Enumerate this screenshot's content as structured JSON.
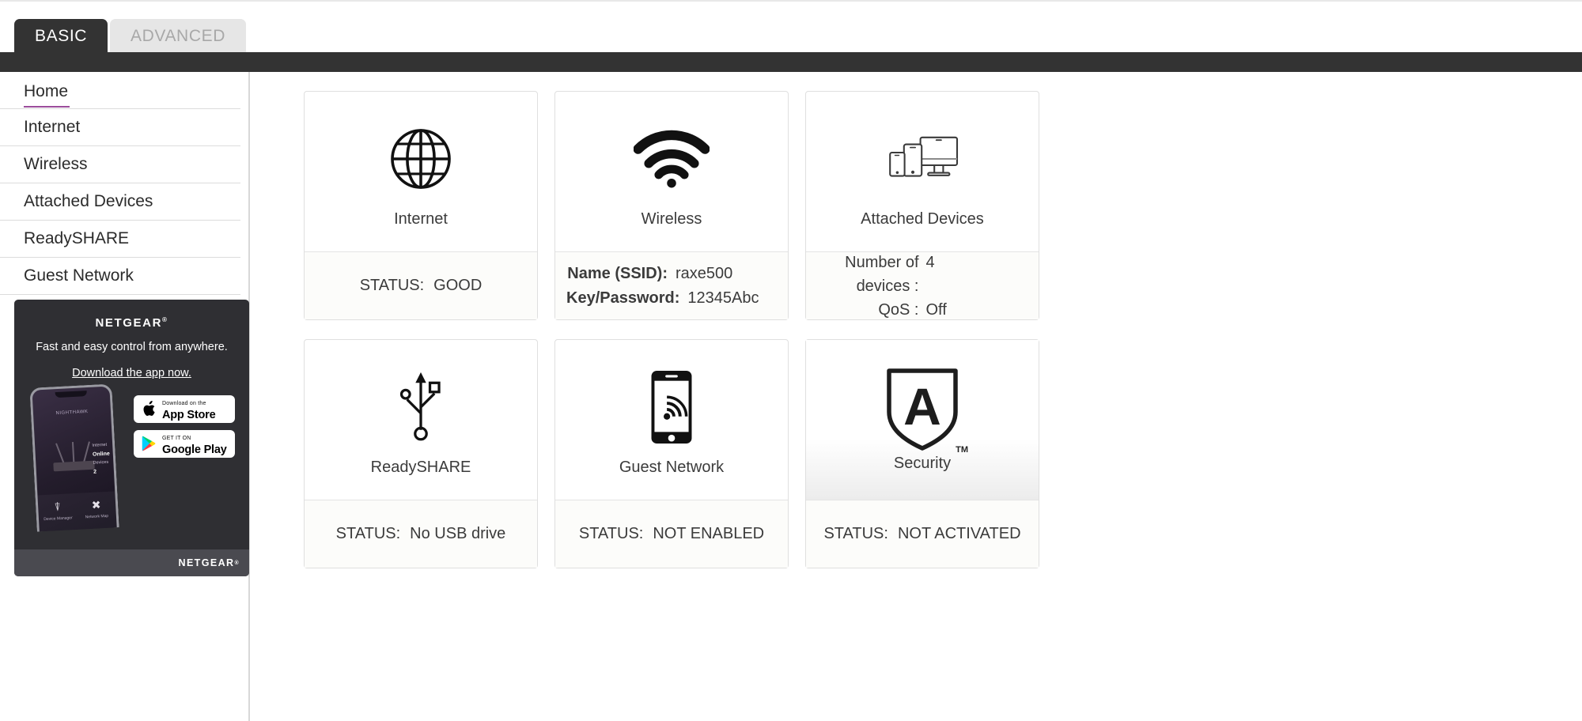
{
  "tabs": [
    {
      "label": "BASIC",
      "active": true
    },
    {
      "label": "ADVANCED",
      "active": false
    }
  ],
  "sidebar": {
    "items": [
      {
        "label": "Home",
        "active": true
      },
      {
        "label": "Internet",
        "active": false
      },
      {
        "label": "Wireless",
        "active": false
      },
      {
        "label": "Attached Devices",
        "active": false
      },
      {
        "label": "ReadySHARE",
        "active": false
      },
      {
        "label": "Guest Network",
        "active": false
      }
    ],
    "active_accent": "#9c4d9c"
  },
  "promo": {
    "brand": "NETGEAR",
    "trademark": "®",
    "tagline": "Fast and easy control from anywhere.",
    "link": "Download the app now.",
    "phone": {
      "app_title": "NIGHTHAWK",
      "status_label": "Internet",
      "status_value": "Online",
      "devices_label": "Devices",
      "devices_value": "2",
      "foot_left": "Device Manager",
      "foot_right": "Network Map"
    },
    "badges": [
      {
        "small": "Download on the",
        "big": "App Store",
        "icon": "apple-icon"
      },
      {
        "small": "GET IT ON",
        "big": "Google Play",
        "icon": "google-play-icon"
      }
    ],
    "footer_brand": "NETGEAR",
    "footer_trademark": "®"
  },
  "cards": [
    {
      "id": "internet",
      "icon": "globe-icon",
      "label": "Internet",
      "foot_type": "status",
      "status_label": "STATUS:",
      "status_value": "GOOD"
    },
    {
      "id": "wireless",
      "icon": "wifi-icon",
      "label": "Wireless",
      "foot_type": "pairs_bold",
      "rows": [
        {
          "key": "Name (SSID):",
          "value": "raxe500"
        },
        {
          "key": "Key/Password:",
          "value": "12345Abc"
        }
      ]
    },
    {
      "id": "attached-devices",
      "icon": "devices-icon",
      "label": "Attached Devices",
      "foot_type": "pairs",
      "rows": [
        {
          "key": "Number of devices :",
          "value": "4"
        },
        {
          "key": "QoS :",
          "value": "Off"
        }
      ]
    },
    {
      "id": "readyshare",
      "icon": "usb-icon",
      "label": "ReadySHARE",
      "foot_type": "status",
      "status_label": "STATUS:",
      "status_value": "No USB drive"
    },
    {
      "id": "guest-network",
      "icon": "phone-wifi-icon",
      "label": "Guest Network",
      "foot_type": "status",
      "status_label": "STATUS:",
      "status_value": "NOT ENABLED"
    },
    {
      "id": "security",
      "icon": "armor-shield-icon",
      "label": "Security",
      "trademark": "TM",
      "foot_type": "status",
      "status_label": "STATUS:",
      "status_value": "NOT ACTIVATED"
    }
  ]
}
